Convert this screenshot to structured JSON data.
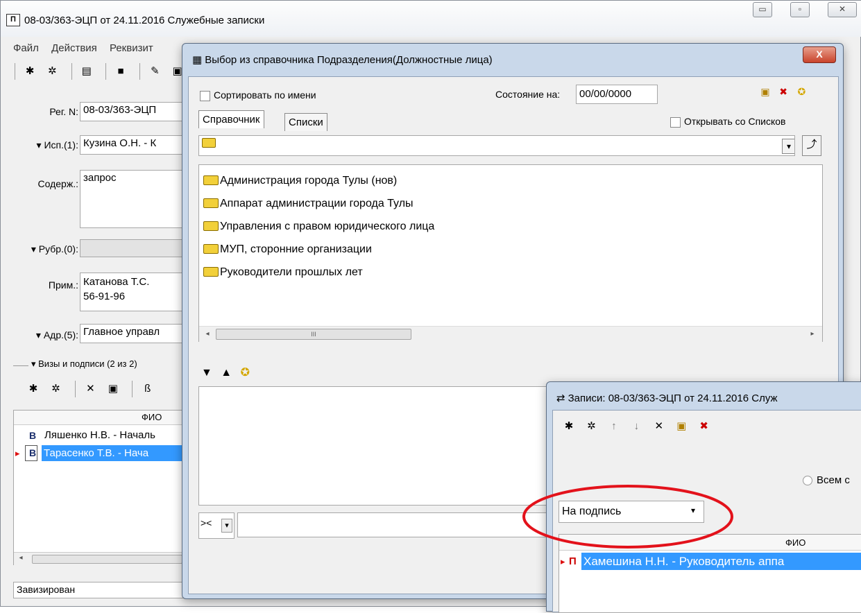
{
  "main": {
    "title": "08-03/363-ЭЦП от 24.11.2016 Служебные записки",
    "app_icon_text": "П",
    "menu": [
      "Файл",
      "Действия",
      "Реквизит"
    ],
    "labels": {
      "reg": "Рег. N:",
      "isp": "Исп.(1):",
      "sod": "Содерж.:",
      "rubr": "Рубр.(0):",
      "prim": "Прим.:",
      "adr": "Адр.(5):",
      "vizy": "Визы и подписи (2 из 2)"
    },
    "values": {
      "reg": "08-03/363-ЭЦП",
      "isp": "Кузина О.Н. - К",
      "sod": "запрос",
      "rubr": "",
      "prim_line1": "Катанова Т.С.",
      "prim_line2": "56-91-96",
      "adr": "Главное управл"
    },
    "grid": {
      "header": "ФИО",
      "rows": [
        {
          "type": "В",
          "name": "Ляшенко Н.В. - Началь"
        },
        {
          "type": "В",
          "name": "Тарасенко Т.В. - Нача"
        }
      ],
      "selected_row": 1
    },
    "status": "Завизирован",
    "window_buttons": [
      "▭",
      "▫",
      "✕"
    ],
    "scroll_left": "◂"
  },
  "dialog": {
    "title": "Выбор из справочника Подразделения(Должностные лица)",
    "sort_by_name": "Сортировать по имени",
    "state_label": "Состояние на:",
    "state_value": "00/00/0000",
    "tabs": [
      "Справочник",
      "Списки"
    ],
    "open_with_lists": "Открывать со Списков",
    "tree_items": [
      "Администрация города Тулы (нов)",
      "Аппарат администрации города Тулы",
      "Управления с правом юридического лица",
      "МУП, сторонние организации",
      "Руководители прошлых лет"
    ],
    "hscroll_grip": "III",
    "search_mode": "><",
    "search_value": "",
    "close": "X",
    "glyphs": {
      "down": "▾",
      "left": "◂",
      "right": "▸",
      "tri_down": "▼",
      "tri_up": "▲"
    }
  },
  "sub": {
    "title": "Записи: 08-03/363-ЭЦП от 24.11.2016 Служ",
    "radio_label": "Всем с",
    "dropdown_value": "На подпись",
    "header": "ФИО",
    "rows": [
      {
        "type": "П",
        "name": "Хамешина Н.Н. - Руководитель аппа"
      }
    ],
    "dropdown_arrow": "▾",
    "row_marker": "▸"
  },
  "colors": {
    "selection": "#3399ff",
    "highlight_ellipse": "#e3121b",
    "folder": "#f2d03a"
  }
}
